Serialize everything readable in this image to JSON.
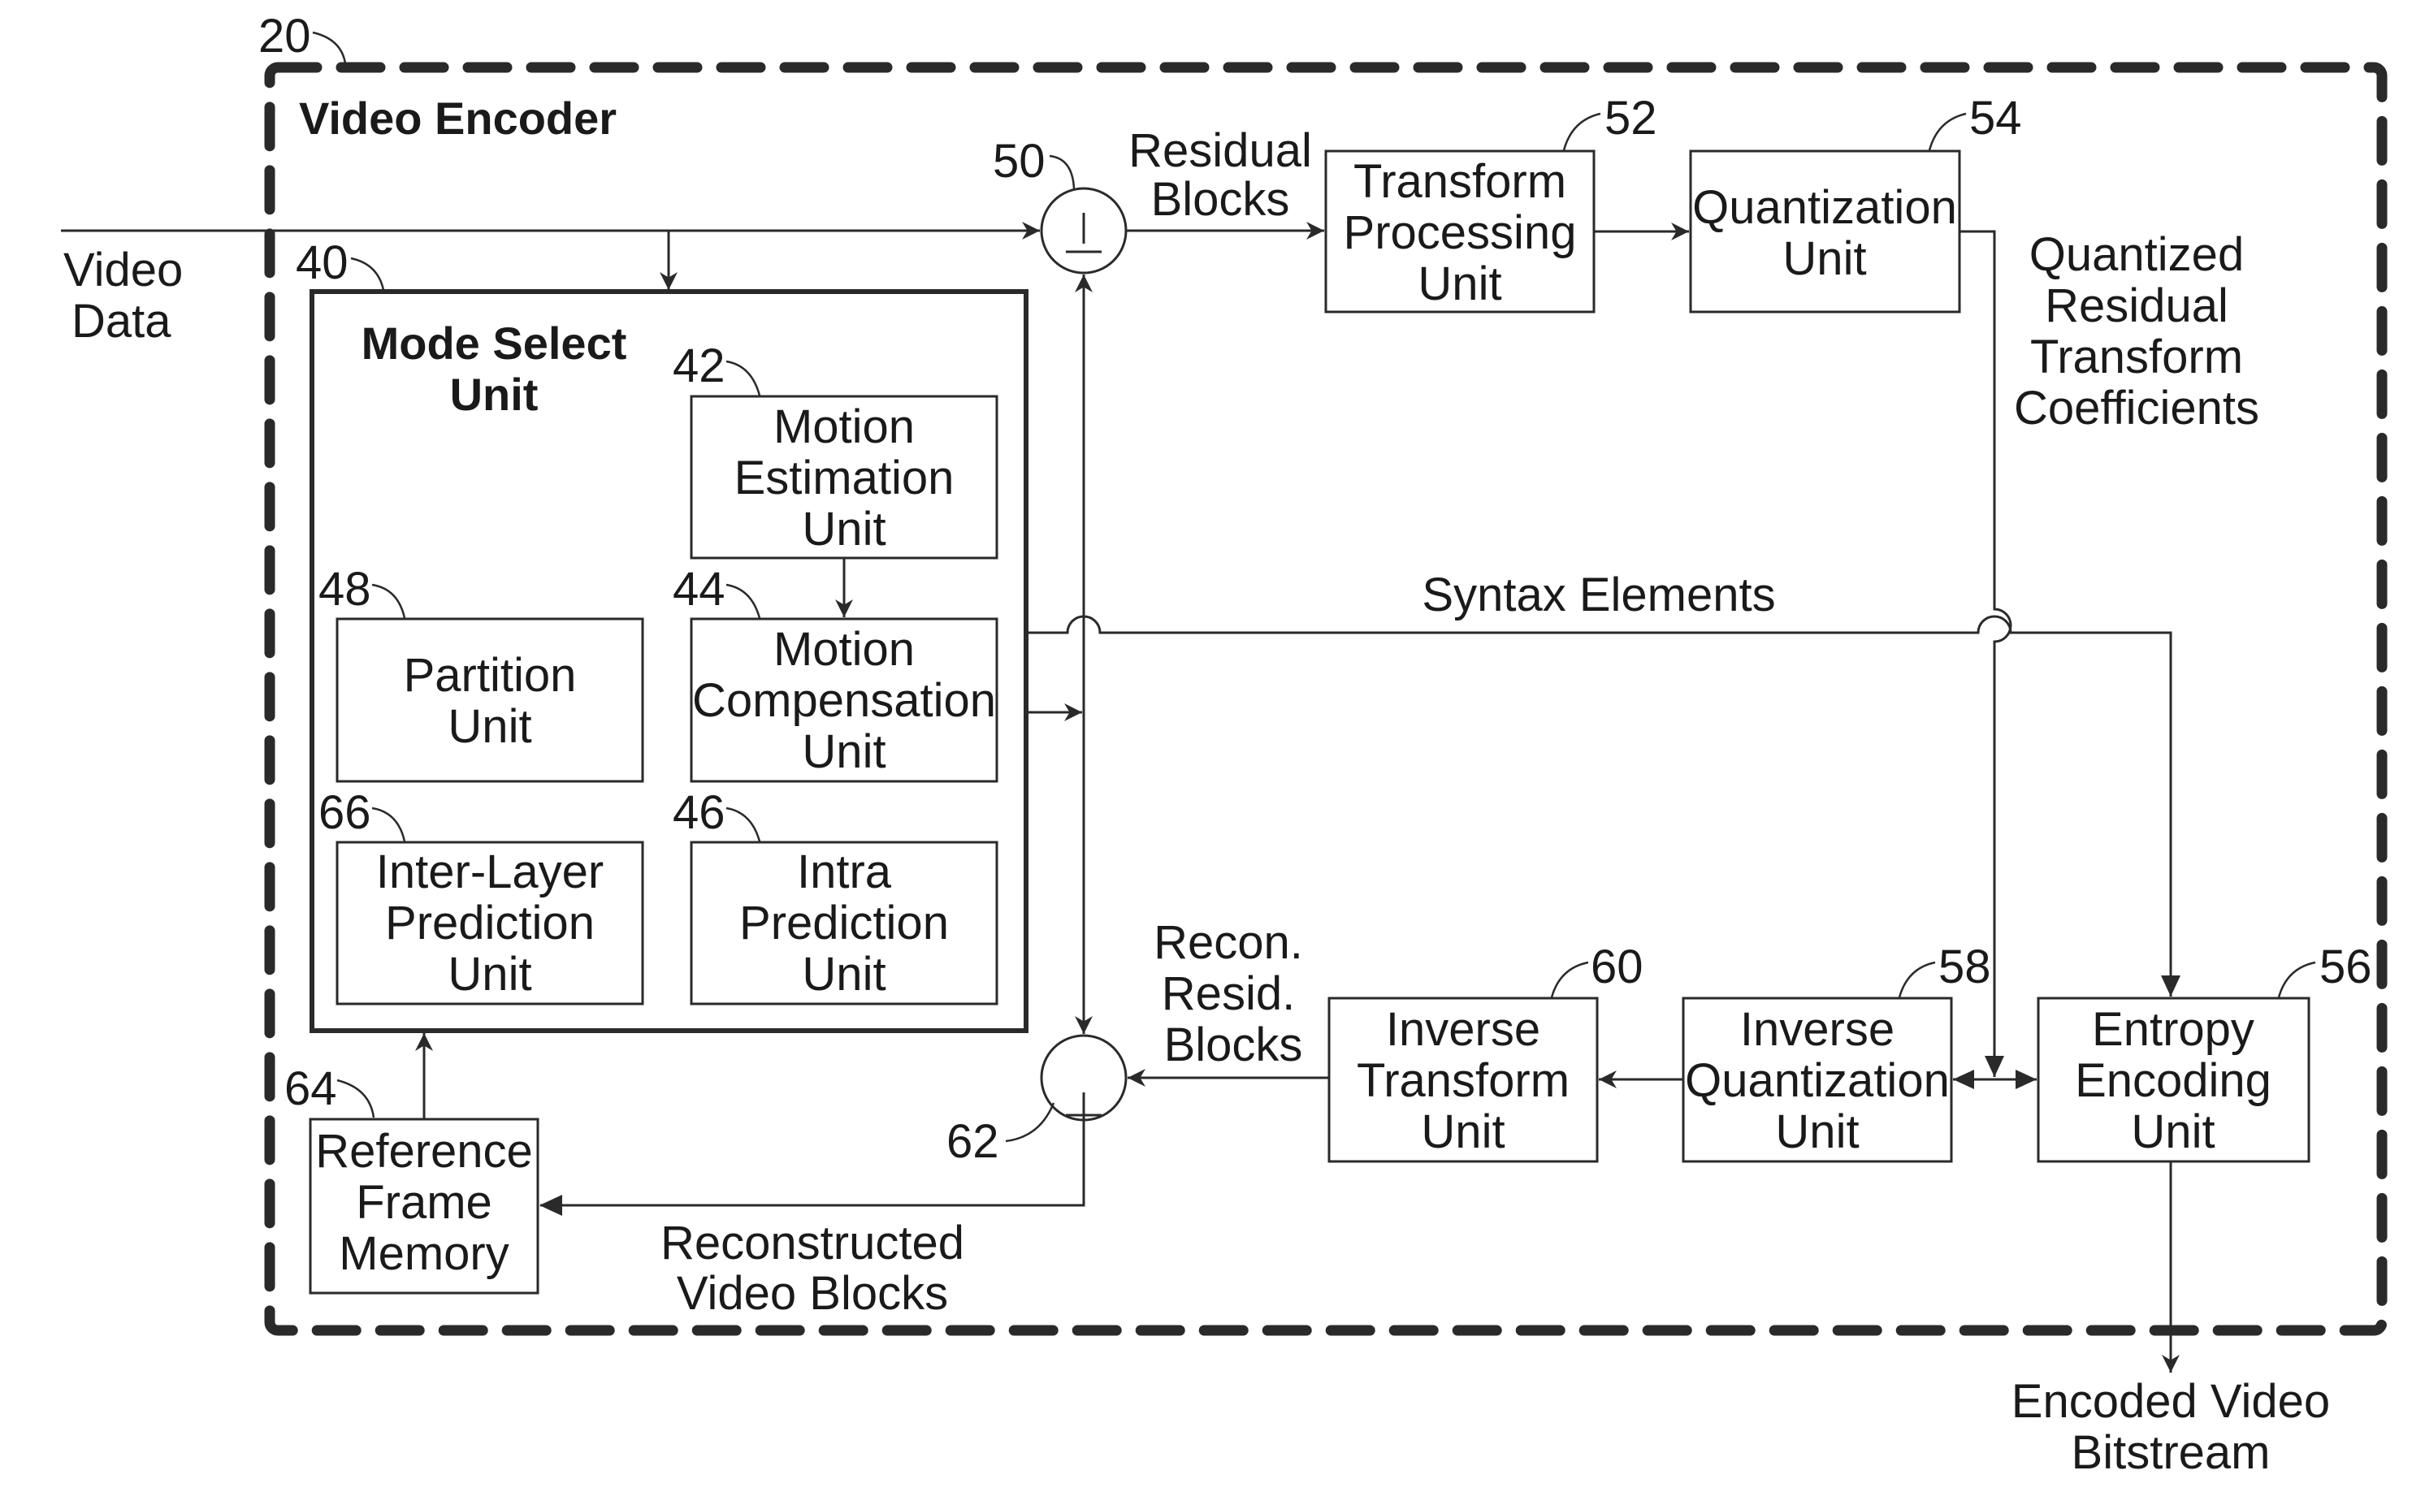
{
  "figure": {
    "encoder": {
      "ref": "20",
      "title": "Video Encoder"
    },
    "input_label": [
      "Video",
      "Data"
    ],
    "mode_select": {
      "ref": "40",
      "title": [
        "Mode Select",
        "Unit"
      ]
    },
    "units": {
      "motion_estimation": {
        "ref": "42",
        "lines": [
          "Motion",
          "Estimation",
          "Unit"
        ]
      },
      "motion_compensation": {
        "ref": "44",
        "lines": [
          "Motion",
          "Compensation",
          "Unit"
        ]
      },
      "partition": {
        "ref": "48",
        "lines": [
          "Partition",
          "Unit"
        ]
      },
      "inter_layer": {
        "ref": "66",
        "lines": [
          "Inter-Layer",
          "Prediction",
          "Unit"
        ]
      },
      "intra_prediction": {
        "ref": "46",
        "lines": [
          "Intra",
          "Prediction",
          "Unit"
        ]
      },
      "reference_frame": {
        "ref": "64",
        "lines": [
          "Reference",
          "Frame",
          "Memory"
        ]
      },
      "transform": {
        "ref": "52",
        "lines": [
          "Transform",
          "Processing",
          "Unit"
        ]
      },
      "quantization": {
        "ref": "54",
        "lines": [
          "Quantization",
          "Unit"
        ]
      },
      "inverse_transform": {
        "ref": "60",
        "lines": [
          "Inverse",
          "Transform",
          "Unit"
        ]
      },
      "inverse_quantization": {
        "ref": "58",
        "lines": [
          "Inverse",
          "Quantization",
          "Unit"
        ]
      },
      "entropy": {
        "ref": "56",
        "lines": [
          "Entropy",
          "Encoding",
          "Unit"
        ]
      }
    },
    "summer_top": {
      "ref": "50"
    },
    "summer_bottom": {
      "ref": "62"
    },
    "edge_labels": {
      "residual_blocks": [
        "Residual",
        "Blocks"
      ],
      "quantized_coeffs": [
        "Quantized",
        "Residual",
        "Transform",
        "Coefficients"
      ],
      "syntax_elements": "Syntax Elements",
      "recon_resid": [
        "Recon.",
        "Resid.",
        "Blocks"
      ],
      "reconstructed": [
        "Reconstructed",
        "Video Blocks"
      ],
      "output": [
        "Encoded Video",
        "Bitstream"
      ]
    }
  }
}
